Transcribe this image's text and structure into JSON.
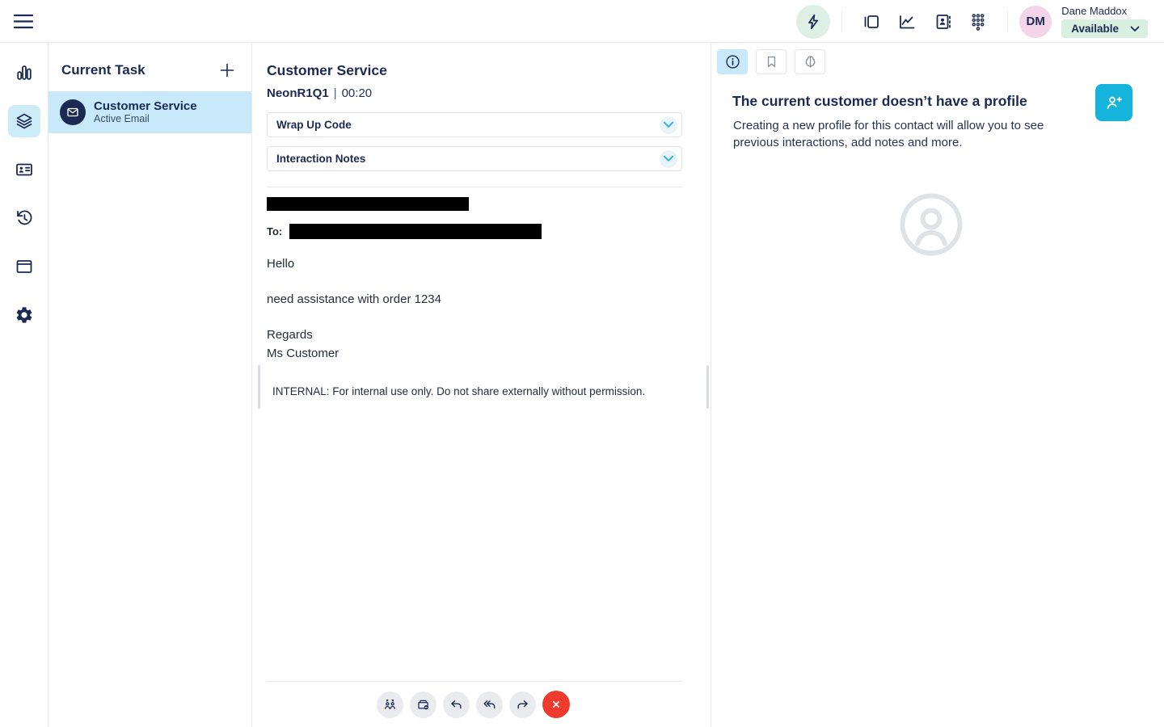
{
  "colors": {
    "navy": "#1b2a52",
    "accent_teal": "#15b4dc",
    "chevron_teal": "#33b6da",
    "active_highlight": "#c7e9f9",
    "danger_red": "#ee3b2e",
    "avatar_pink": "#f3d4e8",
    "status_green_bg": "#d9efe0",
    "boost_green_bg": "#def0e5",
    "placeholder_gray": "#dfe3e8"
  },
  "header": {
    "user_initials": "DM",
    "user_name": "Dane Maddox",
    "status": "Available"
  },
  "task_panel": {
    "title": "Current Task",
    "item": {
      "title": "Customer Service",
      "subtitle": "Active Email"
    }
  },
  "main": {
    "title": "Customer Service",
    "interaction_code": "NeonR1Q1",
    "separator": "|",
    "timer": "00:20",
    "accordions": [
      {
        "label": "Wrap Up Code"
      },
      {
        "label": "Interaction Notes"
      }
    ],
    "email": {
      "to_label": "To:",
      "greeting": "Hello",
      "body": "need assistance with order 1234",
      "signoff": "Regards",
      "signature": "Ms Customer",
      "internal_note": "INTERNAL: For internal use only. Do not share externally without permission."
    }
  },
  "right_panel": {
    "no_profile_title": "The current customer doesn’t have a profile",
    "no_profile_description": "Creating a new profile for this contact will allow you to see previous interactions, add notes and more."
  }
}
